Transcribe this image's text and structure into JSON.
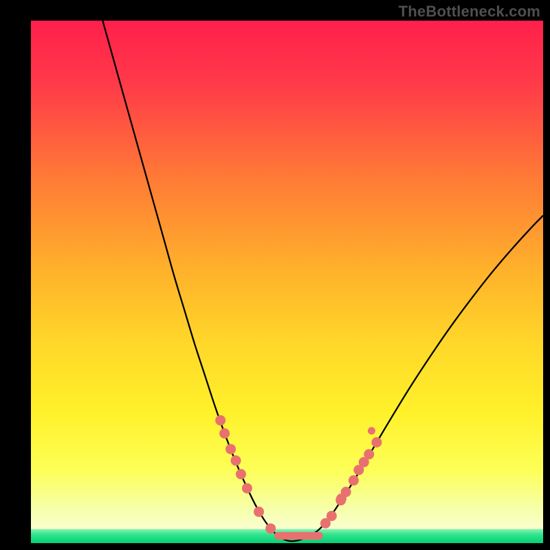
{
  "watermark": "TheBottleneck.com",
  "chart_data": {
    "type": "line",
    "title": "",
    "xlabel": "",
    "ylabel": "",
    "xlim": [
      0,
      100
    ],
    "ylim": [
      0,
      100
    ],
    "curve": [
      {
        "x": 14.0,
        "y": 100.0
      },
      {
        "x": 16.0,
        "y": 93.0
      },
      {
        "x": 18.0,
        "y": 86.0
      },
      {
        "x": 20.0,
        "y": 79.0
      },
      {
        "x": 22.0,
        "y": 72.0
      },
      {
        "x": 24.0,
        "y": 65.0
      },
      {
        "x": 26.0,
        "y": 58.0
      },
      {
        "x": 28.0,
        "y": 51.0
      },
      {
        "x": 30.0,
        "y": 44.5
      },
      {
        "x": 32.0,
        "y": 38.0
      },
      {
        "x": 34.0,
        "y": 32.0
      },
      {
        "x": 36.0,
        "y": 26.0
      },
      {
        "x": 38.0,
        "y": 20.5
      },
      {
        "x": 40.0,
        "y": 15.5
      },
      {
        "x": 42.0,
        "y": 11.0
      },
      {
        "x": 44.0,
        "y": 7.0
      },
      {
        "x": 46.0,
        "y": 3.8
      },
      {
        "x": 48.0,
        "y": 1.6
      },
      {
        "x": 50.0,
        "y": 0.5
      },
      {
        "x": 52.0,
        "y": 0.5
      },
      {
        "x": 54.0,
        "y": 1.2
      },
      {
        "x": 56.0,
        "y": 2.4
      },
      {
        "x": 58.0,
        "y": 4.5
      },
      {
        "x": 60.0,
        "y": 7.3
      },
      {
        "x": 62.0,
        "y": 10.3
      },
      {
        "x": 64.0,
        "y": 13.5
      },
      {
        "x": 66.0,
        "y": 16.8
      },
      {
        "x": 70.0,
        "y": 23.4
      },
      {
        "x": 74.0,
        "y": 29.8
      },
      {
        "x": 78.0,
        "y": 35.8
      },
      {
        "x": 82.0,
        "y": 41.5
      },
      {
        "x": 86.0,
        "y": 46.8
      },
      {
        "x": 90.0,
        "y": 51.8
      },
      {
        "x": 94.0,
        "y": 56.4
      },
      {
        "x": 98.0,
        "y": 60.7
      },
      {
        "x": 100.0,
        "y": 62.7
      }
    ],
    "markers_left": [
      {
        "x": 37.0,
        "y": 23.5
      },
      {
        "x": 37.8,
        "y": 21.0
      },
      {
        "x": 39.0,
        "y": 18.0
      },
      {
        "x": 40.0,
        "y": 15.8
      },
      {
        "x": 41.0,
        "y": 13.2
      },
      {
        "x": 42.2,
        "y": 10.5
      },
      {
        "x": 44.5,
        "y": 6.0
      },
      {
        "x": 46.8,
        "y": 2.8
      }
    ],
    "markers_right": [
      {
        "x": 57.5,
        "y": 3.8
      },
      {
        "x": 58.7,
        "y": 5.2
      },
      {
        "x": 60.5,
        "y": 8.2
      },
      {
        "x": 60.6,
        "y": 8.5
      },
      {
        "x": 61.5,
        "y": 9.8
      },
      {
        "x": 63.0,
        "y": 12.0
      },
      {
        "x": 64.0,
        "y": 14.0
      },
      {
        "x": 65.0,
        "y": 15.5
      },
      {
        "x": 66.0,
        "y": 17.0
      },
      {
        "x": 67.5,
        "y": 19.3
      }
    ],
    "markers_right_misc": [
      {
        "x": 66.5,
        "y": 21.5
      }
    ],
    "bottom_segment": {
      "x0": 47.5,
      "x1": 57.0,
      "y": 1.4
    },
    "colors": {
      "curve": "#000000",
      "marker": "#e8716f",
      "segment": "#e8716f",
      "greenBand": "#19e07f"
    }
  }
}
